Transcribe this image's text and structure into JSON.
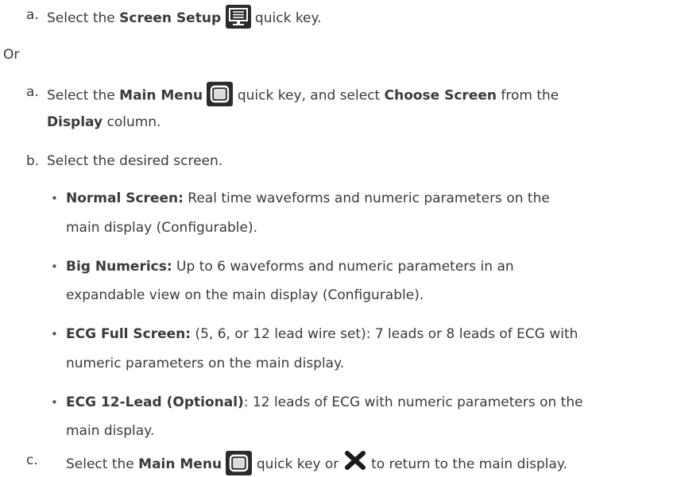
{
  "step1": {
    "marker": "a.",
    "pre": "Select the ",
    "bold": "Screen Setup",
    "post": " quick key.",
    "icon": "screen-setup-icon"
  },
  "or_label": "Or",
  "step2": {
    "marker": "a.",
    "pre": "Select the ",
    "bold1": "Main Menu",
    "mid": " quick key, and  select ",
    "bold2": "Choose Screen",
    "post": " from the",
    "line2_bold": "Display",
    "line2_post": " column.",
    "icon": "main-menu-icon"
  },
  "step3": {
    "marker": "b.",
    "text": "Select the desired screen."
  },
  "bullets": [
    {
      "bold": "Normal Screen:",
      "line1": " Real time waveforms and numeric parameters on the",
      "line2": "main display (Configurable)."
    },
    {
      "bold": "Big Numerics:",
      "line1": " Up to 6 waveforms and numeric parameters in an",
      "line2": "expandable view on the main display (Configurable)."
    },
    {
      "bold": "ECG Full Screen:",
      "line1": " (5,  6, or 12 lead wire set): 7 leads or 8 leads of ECG with",
      "line2": "numeric parameters on the main display."
    },
    {
      "bold": "ECG 12-Lead (Optional)",
      "line1": ": 12 leads of ECG with numeric parameters on the",
      "line2": "main display."
    }
  ],
  "step4": {
    "marker": "c.",
    "pre": "Select the ",
    "bold": "Main Menu",
    "mid": " quick key or ",
    "post": "  to return to the main display.",
    "icon1": "main-menu-icon",
    "icon2": "close-x-icon"
  }
}
